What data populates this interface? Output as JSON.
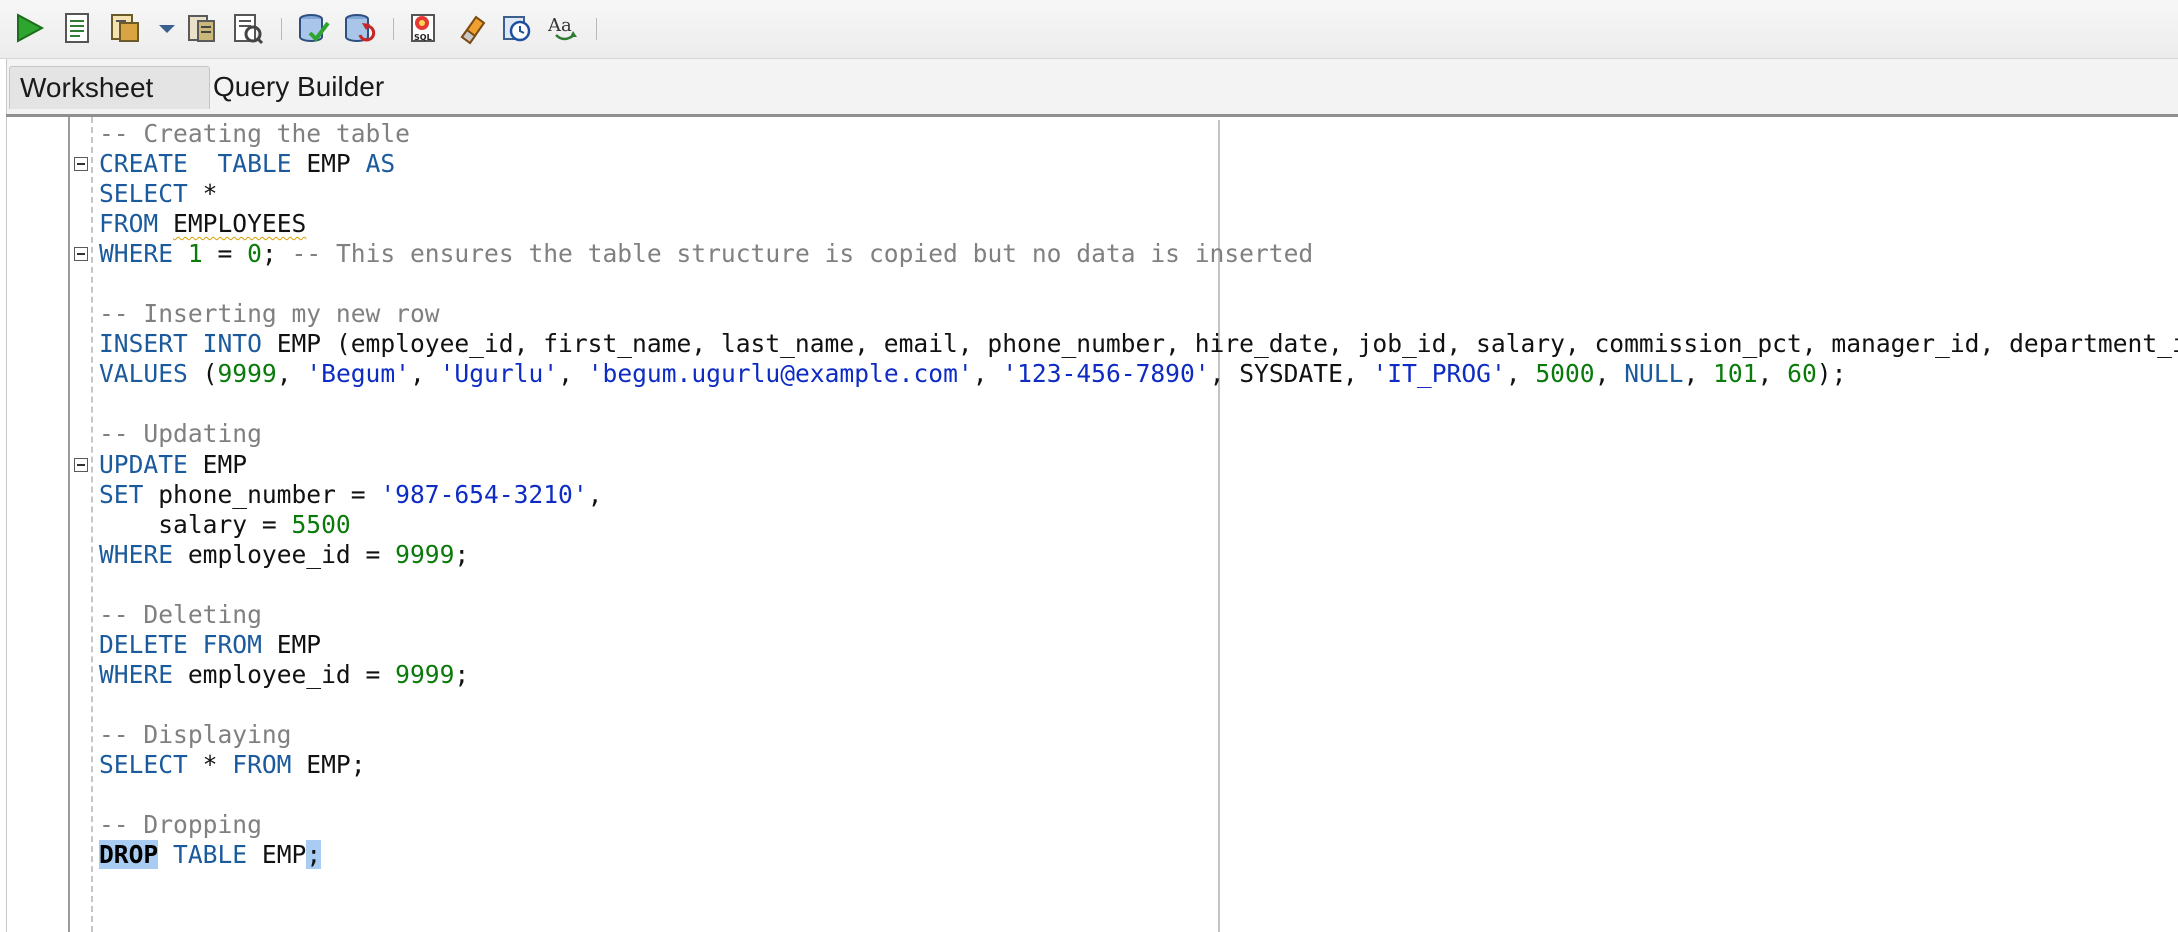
{
  "toolbar": {
    "buttons": [
      {
        "icon": "run-statement-icon"
      },
      {
        "icon": "run-script-icon"
      },
      {
        "icon": "autotrace-icon"
      },
      {
        "icon": "dropdown-arrow-icon"
      },
      {
        "icon": "commit-icon"
      },
      {
        "icon": "rollback-icon"
      },
      {
        "icon": "commit-check-icon"
      },
      {
        "icon": "rollback-check-icon"
      },
      {
        "icon": "sql-tuning-icon"
      },
      {
        "icon": "clear-eraser-icon"
      },
      {
        "icon": "sql-history-icon"
      },
      {
        "icon": "format-text-icon"
      }
    ]
  },
  "tabs": {
    "worksheet": "Worksheet",
    "query_builder": "Query Builder"
  },
  "code_lines": [
    [
      [
        "cm",
        "-- Creating the table"
      ]
    ],
    [
      [
        "kw",
        "CREATE"
      ],
      [
        "",
        "  "
      ],
      [
        "kw",
        "TABLE"
      ],
      [
        "",
        " EMP "
      ],
      [
        "kw",
        "AS"
      ]
    ],
    [
      [
        "kw",
        "SELECT"
      ],
      [
        "",
        " *"
      ]
    ],
    [
      [
        "kw",
        "FROM"
      ],
      [
        "",
        " "
      ],
      [
        "sq",
        "EMPLOYEES"
      ]
    ],
    [
      [
        "kw",
        "WHERE"
      ],
      [
        "",
        " "
      ],
      [
        "nm",
        "1"
      ],
      [
        "",
        " = "
      ],
      [
        "nm",
        "0"
      ],
      [
        "",
        "; "
      ],
      [
        "cm",
        "-- This ensures the table structure is copied but no data is inserted"
      ]
    ],
    [],
    [
      [
        "cm",
        "-- Inserting my new row"
      ]
    ],
    [
      [
        "kw",
        "INSERT"
      ],
      [
        "",
        " "
      ],
      [
        "kw",
        "INTO"
      ],
      [
        "",
        " EMP (employee_id, first_name, last_name, email, phone_number, hire_date, job_id, salary, commission_pct, manager_id, department_id)"
      ]
    ],
    [
      [
        "kw",
        "VALUES"
      ],
      [
        "",
        " ("
      ],
      [
        "nm",
        "9999"
      ],
      [
        "",
        ", "
      ],
      [
        "st",
        "'Begum'"
      ],
      [
        "",
        ", "
      ],
      [
        "st",
        "'Ugurlu'"
      ],
      [
        "",
        ", "
      ],
      [
        "st",
        "'begum.ugurlu@example.com'"
      ],
      [
        "",
        ", "
      ],
      [
        "st",
        "'123-456-7890'"
      ],
      [
        "",
        ", SYSDATE, "
      ],
      [
        "st",
        "'IT_PROG'"
      ],
      [
        "",
        ", "
      ],
      [
        "nm",
        "5000"
      ],
      [
        "",
        ", "
      ],
      [
        "kw",
        "NULL"
      ],
      [
        "",
        ", "
      ],
      [
        "nm",
        "101"
      ],
      [
        "",
        ", "
      ],
      [
        "nm",
        "60"
      ],
      [
        "",
        ");"
      ]
    ],
    [],
    [
      [
        "cm",
        "-- Updating"
      ]
    ],
    [
      [
        "kw",
        "UPDATE"
      ],
      [
        "",
        " EMP"
      ]
    ],
    [
      [
        "kw",
        "SET"
      ],
      [
        "",
        " phone_number = "
      ],
      [
        "st",
        "'987-654-3210'"
      ],
      [
        "",
        ","
      ]
    ],
    [
      [
        "",
        "    salary = "
      ],
      [
        "nm",
        "5500"
      ]
    ],
    [
      [
        "kw",
        "WHERE"
      ],
      [
        "",
        " employee_id = "
      ],
      [
        "nm",
        "9999"
      ],
      [
        "",
        ";"
      ]
    ],
    [],
    [
      [
        "cm",
        "-- Deleting"
      ]
    ],
    [
      [
        "kw",
        "DELETE"
      ],
      [
        "",
        " "
      ],
      [
        "kw",
        "FROM"
      ],
      [
        "",
        " EMP"
      ]
    ],
    [
      [
        "kw",
        "WHERE"
      ],
      [
        "",
        " employee_id = "
      ],
      [
        "nm",
        "9999"
      ],
      [
        "",
        ";"
      ]
    ],
    [],
    [
      [
        "cm",
        "-- Displaying"
      ]
    ],
    [
      [
        "kw",
        "SELECT"
      ],
      [
        "",
        " * "
      ],
      [
        "kw",
        "FROM"
      ],
      [
        "",
        " EMP;"
      ]
    ],
    [],
    [
      [
        "cm",
        "-- Dropping"
      ]
    ],
    [
      [
        "selkw",
        "DROP"
      ],
      [
        "",
        " "
      ],
      [
        "kw",
        "TABLE"
      ],
      [
        "",
        " EMP"
      ],
      [
        "sel",
        ";"
      ]
    ]
  ],
  "fold_markers": [
    1,
    4,
    11
  ],
  "colors": {
    "keyword": "#1b5a9c",
    "comment": "#808080",
    "number": "#0a7a0a",
    "string": "#0e2cc4",
    "selection": "#a9cdf2"
  }
}
